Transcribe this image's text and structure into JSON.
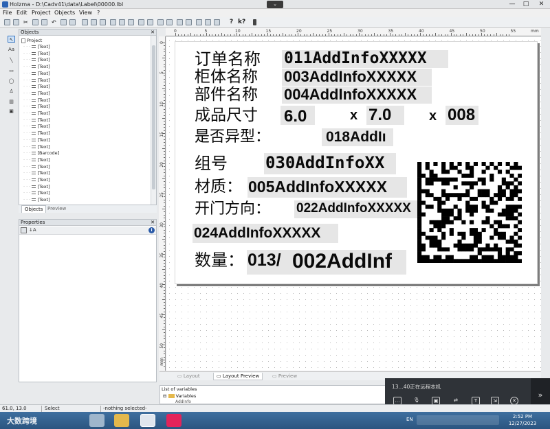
{
  "window": {
    "title": "Holzma - D:\\Cadv41\\data\\Label\\00000.lbl",
    "center_button": "⌄",
    "minimize": "—",
    "maximize": "□",
    "close": "✕"
  },
  "menu": [
    "File",
    "Edit",
    "Project",
    "Objects",
    "View",
    "?"
  ],
  "toolbar": {
    "help": "?",
    "context_help": "k?"
  },
  "tools": [
    "↖",
    "Aa",
    "╲",
    "▭",
    "◯",
    "♙",
    "▥",
    "▣"
  ],
  "objects_panel": {
    "title": "Objects",
    "close": "✕",
    "root": "Project",
    "items": [
      "[Text]",
      "[Text]",
      "[Text]",
      "[Text]",
      "[Text]",
      "[Text]",
      "[Text]",
      "[Text]",
      "[Text]",
      "[Text]",
      "[Text]",
      "[Text]",
      "[Text]",
      "[Text]",
      "[Text]",
      "[Text]",
      "[Barcode]",
      "[Text]",
      "[Text]",
      "[Text]",
      "[Text]",
      "[Text]",
      "[Text]",
      "[Text]"
    ],
    "tabs": [
      "Objects",
      "Preview"
    ]
  },
  "properties_panel": {
    "title": "Properties",
    "close": "✕",
    "info": "i"
  },
  "ruler": {
    "top": [
      "0",
      "5",
      "10",
      "15",
      "20",
      "25",
      "30",
      "35",
      "40",
      "45",
      "50",
      "55"
    ],
    "top_unit": "mm",
    "left": [
      "0",
      "5",
      "10",
      "15",
      "20",
      "25",
      "30",
      "35",
      "40",
      "45",
      "50",
      "55"
    ],
    "left_unit": "mm"
  },
  "label": {
    "row1_label": "订单名称",
    "row1_value": "011AddInfoXXXXX",
    "row2_label": "柜体名称",
    "row2_value": "003AddInfoXXXXX",
    "row3_label": "部件名称",
    "row3_value": "004AddInfoXXXXX",
    "row4_label": "成品尺寸",
    "row4_v1": "6.0",
    "row4_x1": "x",
    "row4_v2": "7.0",
    "row4_x2": "x",
    "row4_v3": "008",
    "row5_label": "是否异型：",
    "row5_value": "018AddIı",
    "row6_label": "组号",
    "row6_value": "030AddInfoXX",
    "row7_label": "材质：",
    "row7_value": "005AddInfoXXXXX",
    "row8_label": "开门方向：",
    "row8_value": "022AddInfoXXXXX",
    "row9_value": "024AddInfoXXXXX",
    "row10_label": "数量：",
    "row10_value_a": "013/",
    "row10_value_b": "002AddInf"
  },
  "view_tabs": [
    "Layout",
    "Layout Preview",
    "Preview"
  ],
  "variables_panel": {
    "title": "List of variables",
    "root": "Variables",
    "child": "AddInfo"
  },
  "remote_overlay": {
    "message": "13...40正在远程本机",
    "expand": "»"
  },
  "status": {
    "coords": "61.0, 13.0",
    "mode": "Select",
    "selection": "-nothing selected-"
  },
  "taskbar": {
    "watermark": "大数跨境",
    "lang": "EN",
    "time": "2:52 PM",
    "date": "12/27/2023"
  }
}
